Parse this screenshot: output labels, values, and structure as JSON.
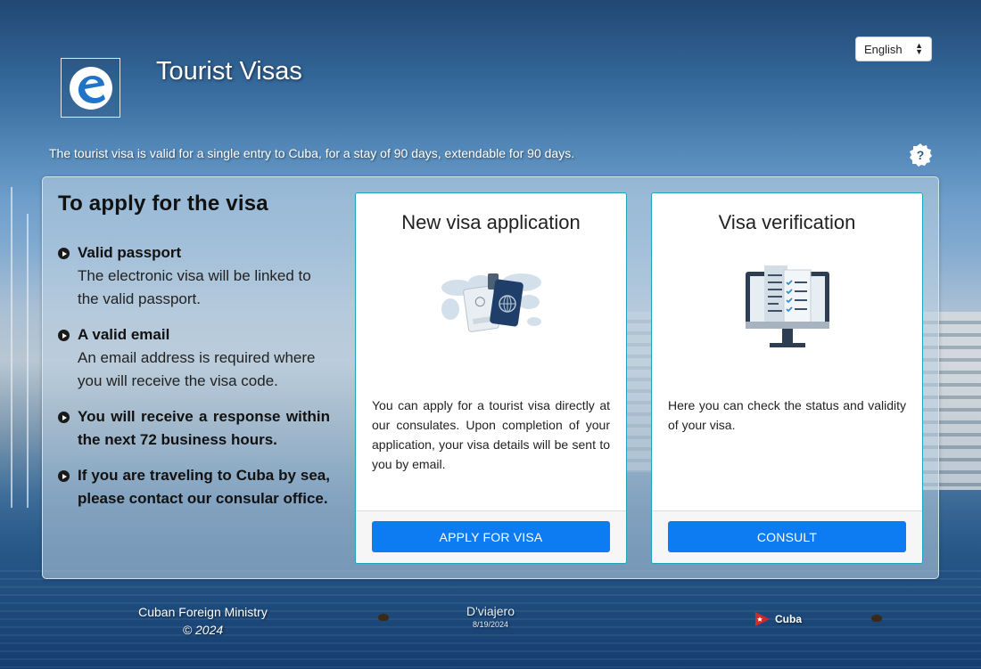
{
  "header": {
    "title": "Tourist Visas",
    "subtitle": "The tourist visa is valid for a single entry to Cuba, for a stay of 90 days, extendable for 90 days.",
    "language": {
      "selected": "English"
    },
    "help_icon": "help-badge-icon",
    "logo_icon": "e-logo-icon"
  },
  "requirements": {
    "heading": "To apply for the visa",
    "items": [
      {
        "head": "Valid passport",
        "desc": "The electronic visa will be linked to the valid passport."
      },
      {
        "head": "A valid email",
        "desc": "An email address is required where you will receive the visa code."
      },
      {
        "head": "You will receive a response within the next 72 business hours.",
        "desc": ""
      },
      {
        "head": "If you are traveling to Cuba by sea, please contact our consular office.",
        "desc": ""
      }
    ]
  },
  "cards": {
    "apply": {
      "title": "New visa application",
      "icon": "passport-world-map-icon",
      "text": "You can apply for a tourist visa directly at our consulates. Upon completion of your application, your visa details will be sent to you by email.",
      "button": "APPLY FOR VISA"
    },
    "verify": {
      "title": "Visa verification",
      "icon": "monitor-checklist-icon",
      "text": "Here you can check the status and validity of your visa.",
      "button": "CONSULT"
    }
  },
  "footer": {
    "ministry": "Cuban Foreign Ministry",
    "year": "© 2024",
    "brand": "D'viajero",
    "date": "8/19/2024",
    "country": "Cuba",
    "flag_icon": "cuba-flag-icon"
  },
  "colors": {
    "button": "#0d7cf2",
    "card_border": "#1fa3b8",
    "text": "#222222"
  }
}
